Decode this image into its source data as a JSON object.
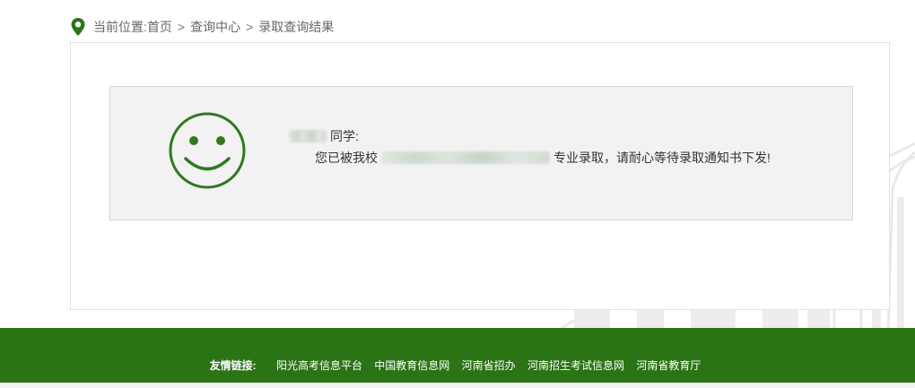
{
  "breadcrumb": {
    "prefix": "当前位置:",
    "items": [
      "首页",
      "查询中心",
      "录取查询结果"
    ],
    "separator": ">"
  },
  "result": {
    "greeting_suffix": "同学:",
    "message_prefix": "您已被我校",
    "message_suffix": "专业录取，请耐心等待录取通知书下发!"
  },
  "footer": {
    "label": "友情链接:",
    "links": [
      "阳光高考信息平台",
      "中国教育信息网",
      "河南省招办",
      "河南招生考试信息网",
      "河南省教育厅"
    ]
  },
  "colors": {
    "brand_green": "#2b7416",
    "smiley_green": "#2f7a1f",
    "result_bg": "#f2f2f2"
  },
  "icons": {
    "location": "location-pin-icon",
    "smiley": "smiley-face-icon"
  }
}
